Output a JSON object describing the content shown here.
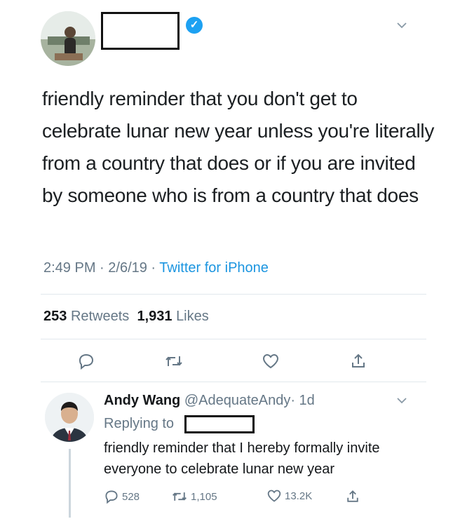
{
  "main_tweet": {
    "text": "friendly reminder that you don't get to celebrate lunar new year unless you're literally from a country that does or if you are invited by someone who is from a country that does",
    "time": "2:49 PM",
    "sep1": " · ",
    "date": "2/6/19",
    "sep2": " · ",
    "source": "Twitter for iPhone",
    "retweets_count": "253",
    "retweets_label": "Retweets",
    "likes_count": "1,931",
    "likes_label": "Likes",
    "verified_icon": "✓"
  },
  "reply": {
    "name": "Andy Wang",
    "handle": "@AdequateAndy",
    "age": "· 1d",
    "replying_to": "Replying to",
    "text": "friendly reminder that I hereby formally invite everyone to celebrate lunar new year",
    "reply_count": "528",
    "retweet_count": "1,105",
    "like_count": "13.2K"
  },
  "icons": {
    "chevron": "⌄"
  },
  "colors": {
    "link": "#1b95e0",
    "muted": "#657786",
    "verified": "#1da1f2"
  }
}
